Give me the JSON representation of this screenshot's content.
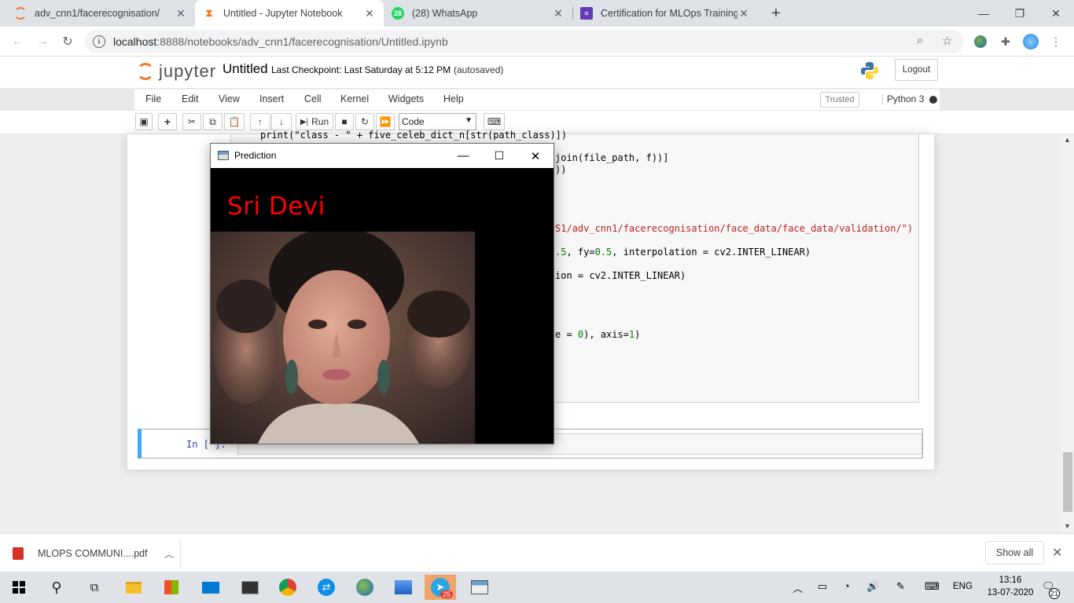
{
  "browser": {
    "tabs": [
      {
        "title": "adv_cnn1/facerecognisation/",
        "icon": "jupyter-icon"
      },
      {
        "title": "Untitled - Jupyter Notebook",
        "icon": "hourglass-icon"
      },
      {
        "title": "(28) WhatsApp",
        "icon": "whatsapp-icon",
        "badge": "28"
      },
      {
        "title": "Certification for MLOps Training",
        "icon": "form-icon"
      }
    ],
    "new_tab": "+",
    "address": {
      "host": "localhost",
      "path": ":8888/notebooks/adv_cnn1/facerecognisation/Untitled.ipynb"
    }
  },
  "jupyter": {
    "logo_text": "jupyter",
    "notebook_name": "Untitled",
    "checkpoint": "Last Checkpoint: Last Saturday at 5:12 PM",
    "autosave": "(autosaved)",
    "logout": "Logout",
    "menus": [
      "File",
      "Edit",
      "View",
      "Insert",
      "Cell",
      "Kernel",
      "Widgets",
      "Help"
    ],
    "trusted": "Trusted",
    "kernel": "Python 3",
    "run_label": "Run",
    "cell_type": "Code"
  },
  "code": {
    "line1": "print(\"class - \" + five_celeb_dict_n[str(path_class)])",
    "line2": "join(file_path, f))]",
    "line3": "))",
    "line4_str": "S1/adv_cnn1/facerecognisation/face_data/face_data/validation/\")",
    "line5_a": ".5",
    "line5_b": ", fy=",
    "line5_c": "0.5",
    "line5_d": ", interpolation = cv2.INTER_LINEAR)",
    "line6": "ion = cv2.INTER_LINEAR)",
    "line7_a": "e = ",
    "line7_b": "0",
    "line7_c": "), axis=",
    "line7_d": "1",
    "line7_e": ")"
  },
  "cell2": {
    "prompt": "In [ ]:"
  },
  "prediction_window": {
    "title": "Prediction",
    "label": "Sri Devi"
  },
  "downloads": {
    "file": "MLOPS COMMUNI....pdf",
    "show_all": "Show all"
  },
  "taskbar": {
    "telegram_badge": "25",
    "lang": "ENG",
    "time": "13:16",
    "date": "13-07-2020",
    "notifications": "21"
  }
}
